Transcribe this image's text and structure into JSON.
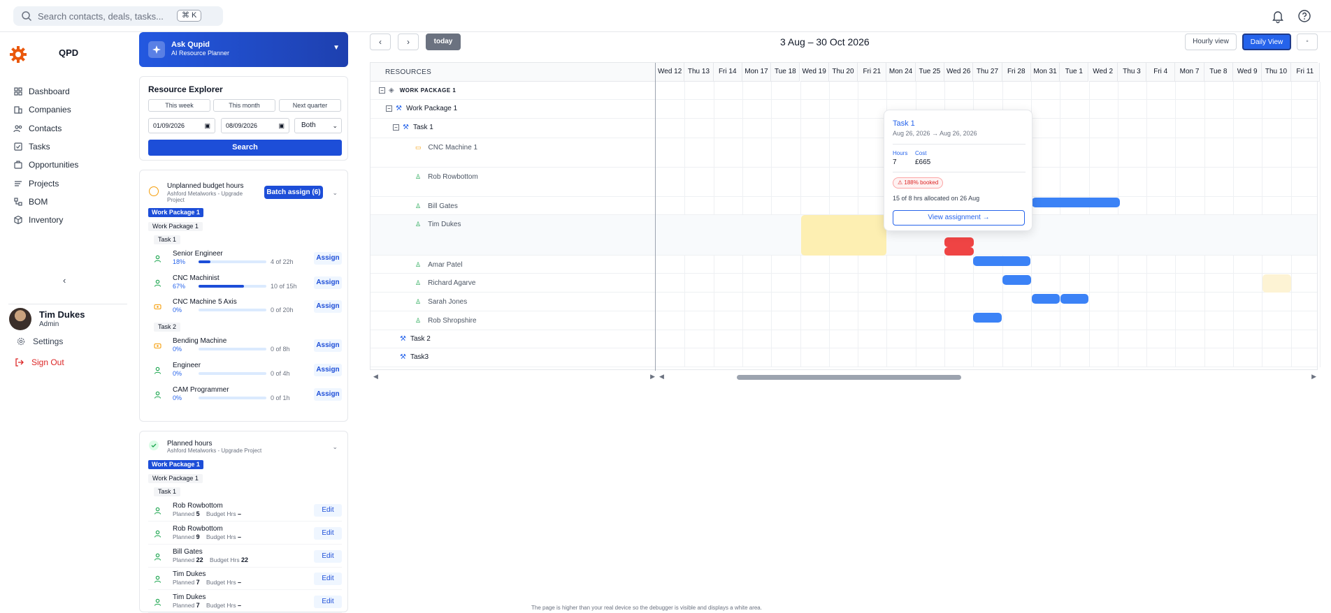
{
  "search": {
    "placeholder": "Search contacts, deals, tasks...",
    "shortcut": "⌘ K"
  },
  "brand": {
    "name": "QPD",
    "color": "#ea580c"
  },
  "nav": [
    {
      "label": "Dashboard",
      "icon": "dashboard-icon"
    },
    {
      "label": "Companies",
      "icon": "building-icon"
    },
    {
      "label": "Contacts",
      "icon": "users-icon"
    },
    {
      "label": "Tasks",
      "icon": "checkbox-icon"
    },
    {
      "label": "Opportunities",
      "icon": "briefcase-icon"
    },
    {
      "label": "Projects",
      "icon": "list-icon"
    },
    {
      "label": "BOM",
      "icon": "network-icon"
    },
    {
      "label": "Inventory",
      "icon": "box-icon"
    }
  ],
  "sidebar": {
    "collapse": "‹",
    "user_name": "Tim Dukes",
    "user_role": "Admin",
    "settings": "Settings",
    "signout": "Sign Out"
  },
  "qupid": {
    "title": "Ask Qupid",
    "subtitle": "AI Resource Planner"
  },
  "explorer": {
    "title": "Resource Explorer",
    "ranges": [
      "This week",
      "This month",
      "Next quarter"
    ],
    "from": "01/09/2026",
    "to": "08/09/2026",
    "type": "Both",
    "search": "Search"
  },
  "unplanned": {
    "title": "Unplanned budget hours",
    "subtitle": "Ashford Metalworks - Upgrade Project",
    "batch": "Batch assign (6)",
    "wp_badge": "Work Package 1",
    "wp_tag": "Work Package 1",
    "task1": "Task 1",
    "task2": "Task 2",
    "rows": [
      {
        "name": "Senior Engineer",
        "pct": "18%",
        "fill": 0.18,
        "hours": "4 of 22h",
        "kind": "person"
      },
      {
        "name": "CNC Machinist",
        "pct": "67%",
        "fill": 0.67,
        "hours": "10 of 15h",
        "kind": "person"
      },
      {
        "name": "CNC Machine 5 Axis",
        "pct": "0%",
        "fill": 0,
        "hours": "0 of 20h",
        "kind": "machine"
      },
      {
        "name": "Bending Machine",
        "pct": "0%",
        "fill": 0,
        "hours": "0 of 8h",
        "kind": "machine"
      },
      {
        "name": "Engineer",
        "pct": "0%",
        "fill": 0,
        "hours": "0 of 4h",
        "kind": "person"
      },
      {
        "name": "CAM Programmer",
        "pct": "0%",
        "fill": 0,
        "hours": "0 of 1h",
        "kind": "person"
      }
    ],
    "assign": "Assign"
  },
  "planned": {
    "title": "Planned hours",
    "subtitle": "Ashford Metalworks - Upgrade Project",
    "wp_badge": "Work Package 1",
    "wp_tag": "Work Package 1",
    "task1": "Task 1",
    "planned_label": "Planned",
    "budget_label": "Budget Hrs",
    "edit": "Edit",
    "rows": [
      {
        "name": "Rob Rowbottom",
        "planned": "5",
        "budget": "–"
      },
      {
        "name": "Rob Rowbottom",
        "planned": "9",
        "budget": "–"
      },
      {
        "name": "Bill Gates",
        "planned": "22",
        "budget": "22"
      },
      {
        "name": "Tim Dukes",
        "planned": "7",
        "budget": "–"
      },
      {
        "name": "Tim Dukes",
        "planned": "7",
        "budget": "–"
      }
    ]
  },
  "gantt": {
    "title": "3 Aug – 30 Oct 2026",
    "today": "today",
    "hourly": "Hourly view",
    "daily": "Daily View",
    "resources_header": "RESOURCES",
    "days": [
      "Wed 12",
      "Thu 13",
      "Fri 14",
      "Mon 17",
      "Tue 18",
      "Wed 19",
      "Thu 20",
      "Fri 21",
      "Mon 24",
      "Tue 25",
      "Wed 26",
      "Thu 27",
      "Fri 28",
      "Mon 31",
      "Tue 1",
      "Wed 2",
      "Thu 3",
      "Fri 4",
      "Mon 7",
      "Tue 8",
      "Wed 9",
      "Thu 10",
      "Fri 11"
    ],
    "rows": [
      {
        "label": "WORK PACKAGE 1",
        "level": 0
      },
      {
        "label": "Work Package 1",
        "level": 1
      },
      {
        "label": "Task 1",
        "level": 2
      },
      {
        "label": "CNC Machine 1",
        "level": 3,
        "kind": "machine"
      },
      {
        "label": "Rob Rowbottom",
        "level": 3,
        "kind": "person"
      },
      {
        "label": "Bill Gates",
        "level": 3,
        "kind": "person"
      },
      {
        "label": "Tim Dukes",
        "level": 3,
        "kind": "person"
      },
      {
        "label": "Amar Patel",
        "level": 3,
        "kind": "person"
      },
      {
        "label": "Richard Agarve",
        "level": 3,
        "kind": "person"
      },
      {
        "label": "Sarah Jones",
        "level": 3,
        "kind": "person"
      },
      {
        "label": "Rob Shropshire",
        "level": 3,
        "kind": "person"
      },
      {
        "label": "Task 2",
        "level": 2
      },
      {
        "label": "Task3",
        "level": 2
      }
    ]
  },
  "tooltip": {
    "title": "Task 1",
    "dates": "Aug 26, 2026 → Aug 26, 2026",
    "hours_label": "Hours",
    "hours": "7",
    "cost_label": "Cost",
    "cost": "£665",
    "badge": "⚠ 188% booked",
    "allocation": "15 of 8 hrs allocated on 26 Aug",
    "button": "View assignment →"
  },
  "footer": "The page is higher than your real device so the debugger is visible and displays a white area."
}
